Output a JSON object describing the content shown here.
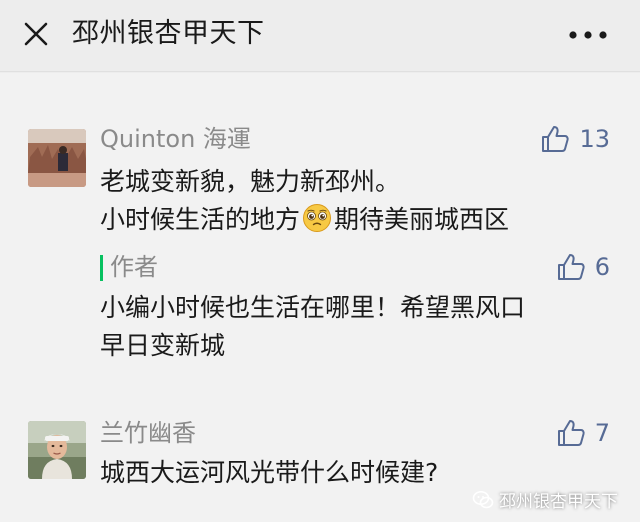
{
  "header": {
    "title": "邳州银杏甲天下",
    "close_icon": "close-icon",
    "more_icon": "more-dots-icon"
  },
  "comments": [
    {
      "name": "Quinton 海運",
      "likes": "13",
      "line1": "老城变新貌，魅力新邳州。",
      "line2_before": "小时候生活的地方",
      "line2_emoji": "pleading-face-emoji",
      "line2_after": "期待美丽城西区",
      "reply": {
        "label": "作者",
        "likes": "6",
        "line1": "小编小时候也生活在哪里！希望黑风口",
        "line2": "早日变新城"
      }
    },
    {
      "name": "兰竹幽香",
      "likes": "7",
      "line1": "城西大运河风光带什么时候建?"
    }
  ],
  "watermark": "邳州银杏甲天下",
  "colors": {
    "accent": "#576b95",
    "author_bar": "#07c160",
    "meta_text": "#8a8a8a",
    "background": "#f2f2f2"
  }
}
